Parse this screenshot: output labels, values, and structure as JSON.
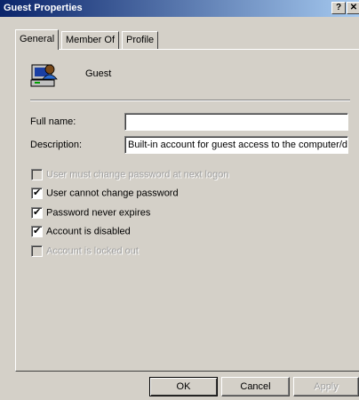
{
  "window": {
    "title": "Guest Properties",
    "help_label": "?",
    "close_label": "✕"
  },
  "tabs": [
    {
      "label": "General"
    },
    {
      "label": "Member Of"
    },
    {
      "label": "Profile"
    }
  ],
  "user": {
    "name": "Guest",
    "icon": "user-computer-icon"
  },
  "form": {
    "full_name": {
      "label": "Full name:",
      "value": ""
    },
    "description": {
      "label": "Description:",
      "value": "Built-in account for guest access to the computer/dc"
    }
  },
  "checkboxes": [
    {
      "label": "User must change password at next logon",
      "checked": false,
      "enabled": false
    },
    {
      "label": "User cannot change password",
      "checked": true,
      "enabled": true
    },
    {
      "label": "Password never expires",
      "checked": true,
      "enabled": true
    },
    {
      "label": "Account is disabled",
      "checked": true,
      "enabled": true
    },
    {
      "label": "Account is locked out",
      "checked": false,
      "enabled": false
    }
  ],
  "buttons": {
    "ok": "OK",
    "cancel": "Cancel",
    "apply": "Apply"
  }
}
